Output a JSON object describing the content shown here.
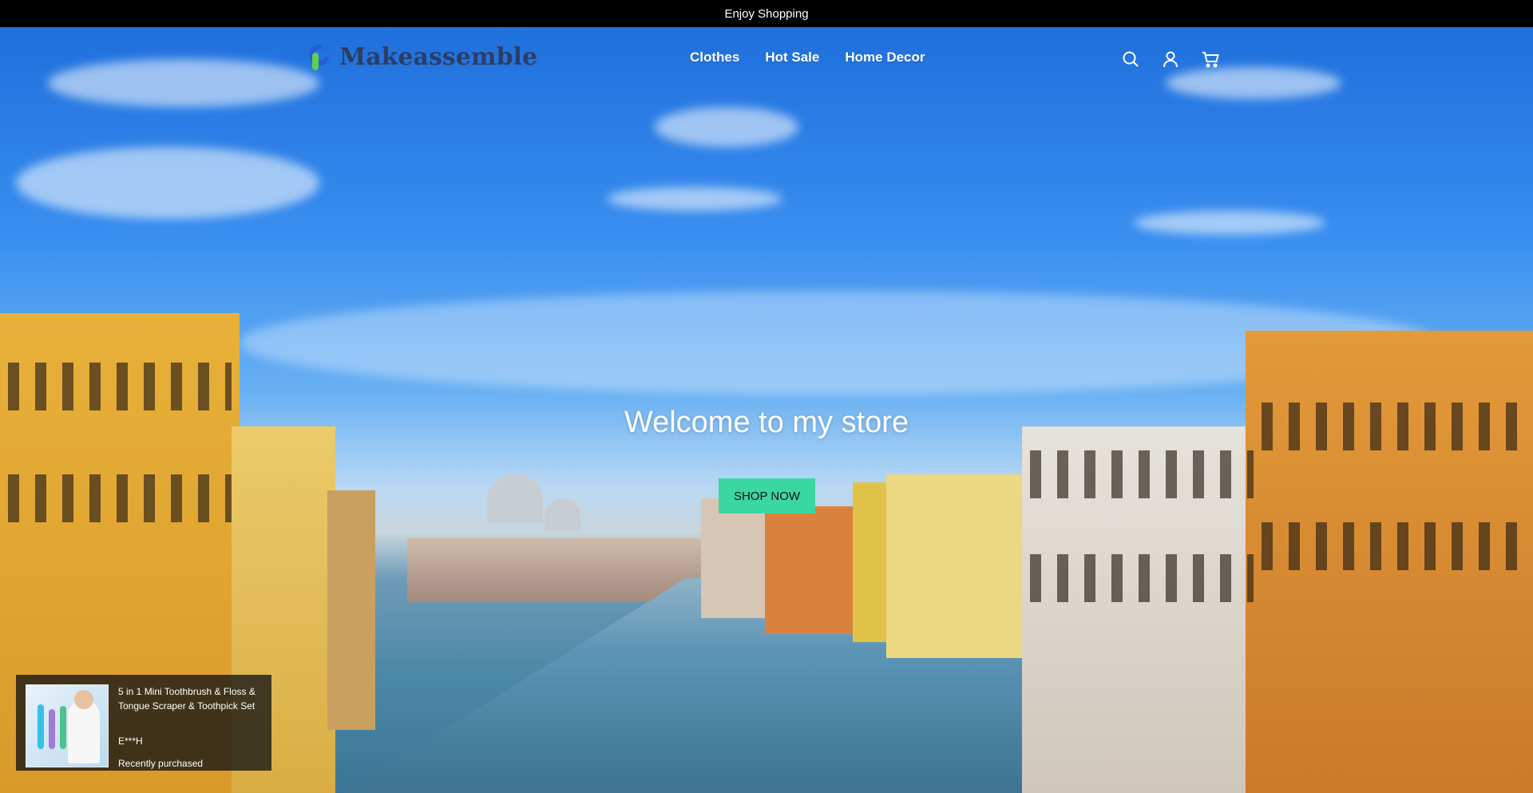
{
  "announcement": {
    "text": "Enjoy Shopping"
  },
  "header": {
    "logo_text": "Makeassemble",
    "nav": [
      {
        "label": "Clothes"
      },
      {
        "label": "Hot Sale"
      },
      {
        "label": "Home Decor"
      }
    ],
    "icons": [
      "search-icon",
      "account-icon",
      "cart-icon"
    ]
  },
  "hero": {
    "title": "Welcome to my store",
    "button_label": "SHOP NOW",
    "button_color": "#3ad7a3"
  },
  "popup": {
    "product_title": "5 in 1 Mini Toothbrush & Floss & Tongue Scraper & Toothpick Set",
    "buyer": "E***H",
    "status": "Recently purchased"
  }
}
